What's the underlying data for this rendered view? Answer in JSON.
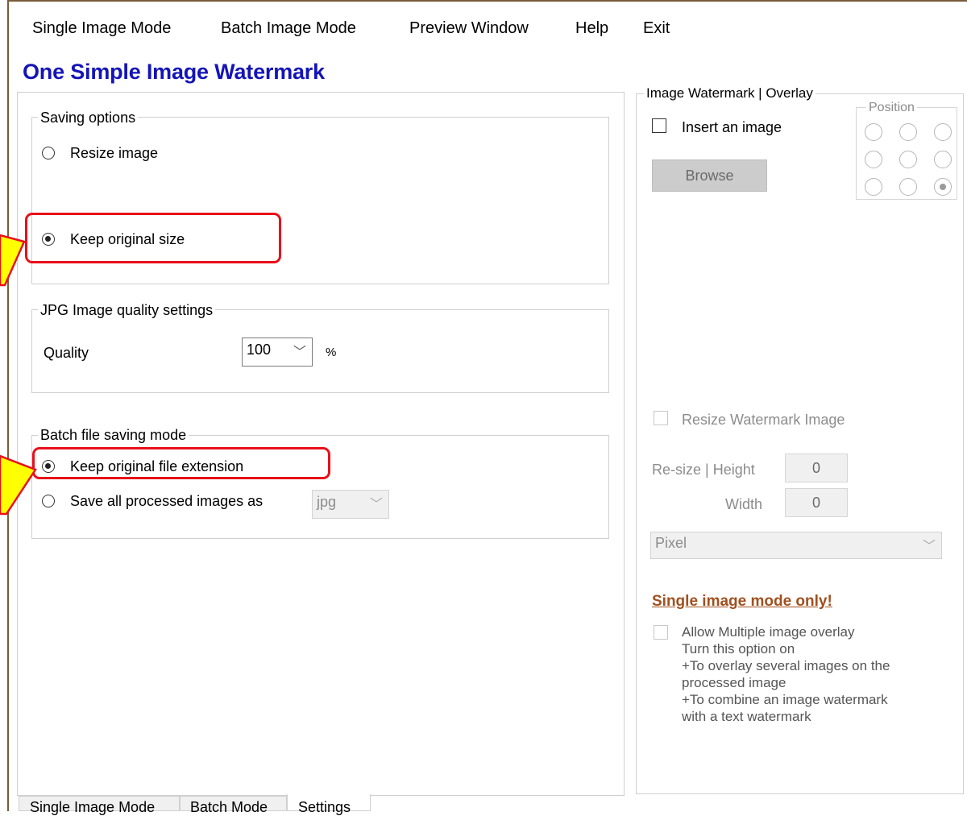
{
  "menu": {
    "single_image_mode": "Single Image Mode",
    "batch_image_mode": "Batch Image Mode",
    "preview_window": "Preview Window",
    "help": "Help",
    "exit": "Exit"
  },
  "app_title": "One Simple Image Watermark",
  "saving_options": {
    "legend": "Saving options",
    "resize_image": "Resize image",
    "keep_original_size": "Keep original size",
    "selected": "keep_original_size"
  },
  "jpg_quality": {
    "legend": "JPG Image quality settings",
    "label": "Quality",
    "value": "100",
    "unit": "%"
  },
  "batch_saving": {
    "legend": "Batch file saving mode",
    "keep_extension": "Keep original file extension",
    "save_all_as": "Save all processed images as",
    "format_value": "jpg",
    "selected": "keep_extension"
  },
  "image_watermark": {
    "legend": "Image Watermark | Overlay",
    "insert_image": "Insert an image",
    "browse": "Browse",
    "position_legend": "Position",
    "position_selected": 9,
    "resize_watermark": "Resize Watermark Image",
    "resize_height_label": "Re-size | Height",
    "height_value": "0",
    "width_label": "Width",
    "width_value": "0",
    "unit_value": "Pixel",
    "single_mode_only": "Single image mode only!",
    "allow_multiple": "Allow Multiple image overlay",
    "note_lines": [
      "Turn this option on",
      "+To overlay several images on the",
      "processed image",
      "+To combine an image watermark",
      "with a text watermark"
    ]
  },
  "tabs": {
    "single": "Single Image Mode",
    "batch": "Batch Mode",
    "settings": "Settings",
    "active": "settings"
  },
  "colors": {
    "title": "#1414b8",
    "highlight": "#e8101a",
    "arrow_fill": "#ffff00",
    "arrow_outline": "#e8101a",
    "warning_link": "#a0501e"
  }
}
